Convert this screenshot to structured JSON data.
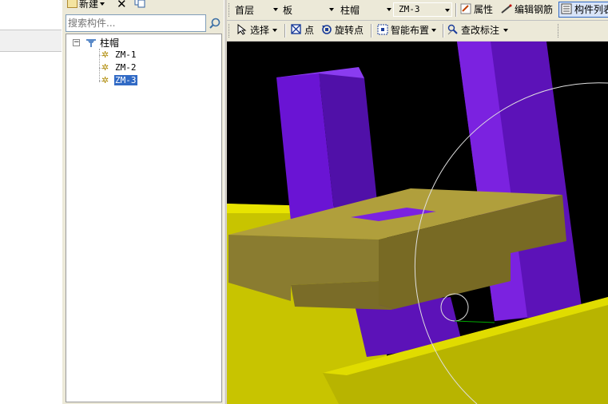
{
  "left_toolbar": {
    "new_label": "新建",
    "delete_icon": "close-icon",
    "copy_icon": "copy-icon"
  },
  "search": {
    "placeholder": "搜索构件..."
  },
  "tree": {
    "root_label": "柱帽",
    "items": [
      {
        "label": "ZM-1",
        "selected": false
      },
      {
        "label": "ZM-2",
        "selected": false
      },
      {
        "label": "ZM-3",
        "selected": true
      }
    ]
  },
  "toolbar1": {
    "floor_value": "首层",
    "category_value": "板",
    "type_value": "柱帽",
    "component_value": "ZM-3",
    "property_label": "属性",
    "edit_rebar_label": "编辑钢筋",
    "component_list_label": "构件列表"
  },
  "toolbar2": {
    "select_label": "选择",
    "point_label": "点",
    "rotate_point_label": "旋转点",
    "smart_layout_label": "智能布置",
    "check_annotation_label": "查改标注"
  },
  "colors": {
    "column_purple": "#6b0fd6",
    "slab_yellow": "#c8c400",
    "cap_olive": "#8a7c30",
    "selection_blue": "#316ac5"
  }
}
